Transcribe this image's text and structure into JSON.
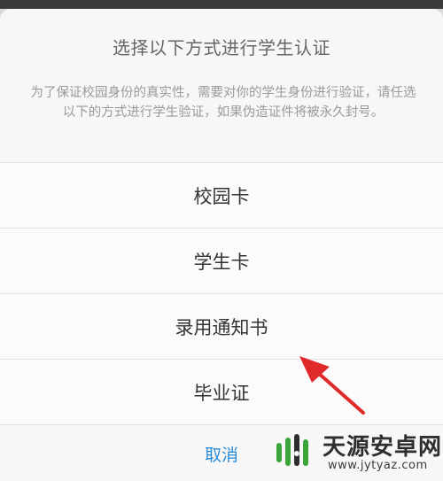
{
  "dialog": {
    "title": "选择以下方式进行学生认证",
    "description": "为了保证校园身份的真实性，需要对你的学生身份进行验证，请任选以下的方式进行学生验证，如果伪造证件将被永久封号。",
    "options": [
      {
        "label": "校园卡"
      },
      {
        "label": "学生卡"
      },
      {
        "label": "录用通知书"
      },
      {
        "label": "毕业证"
      }
    ],
    "cancel_label": "取消"
  },
  "annotation": {
    "arrow_color": "#e02a2a"
  },
  "watermark": {
    "name": "天源安卓网",
    "url": "www.jytyaz.com",
    "logo_icon": "android-logo-icon"
  },
  "colors": {
    "accent": "#2a8bd8",
    "brand_green": "#3aa63a"
  }
}
